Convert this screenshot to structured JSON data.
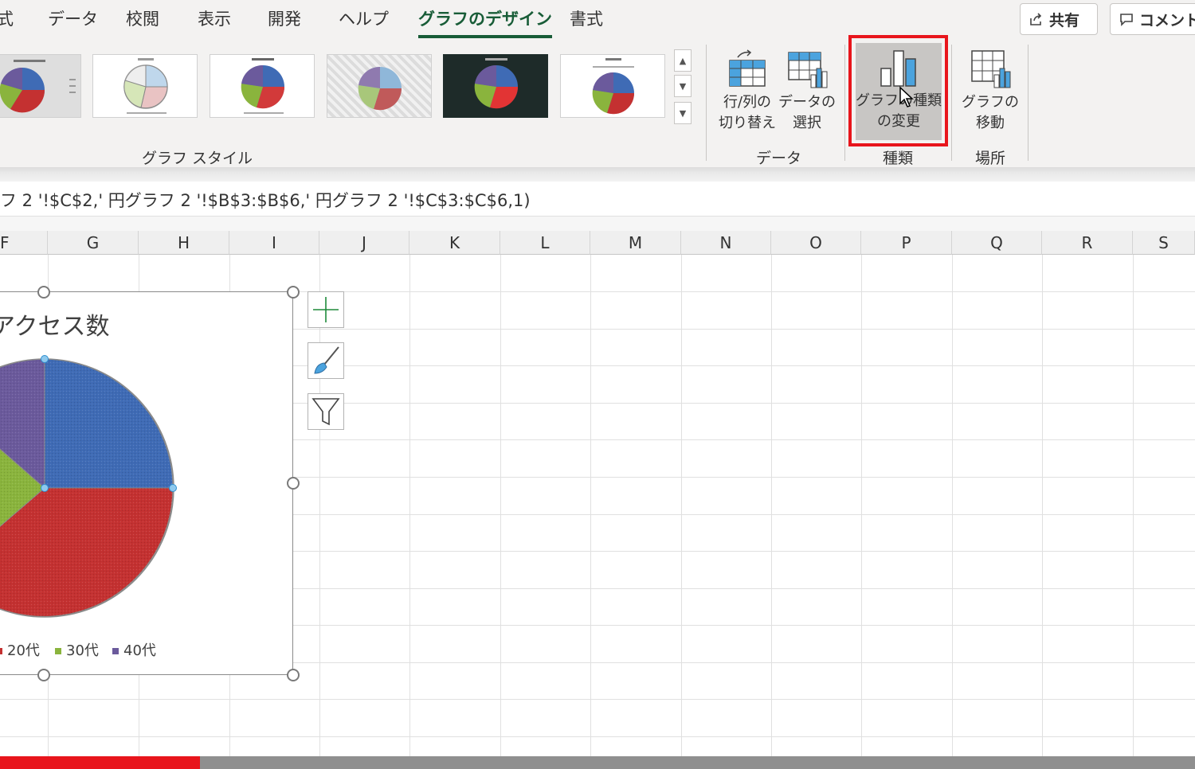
{
  "tabs": [
    {
      "label": "式",
      "active": false
    },
    {
      "label": "データ",
      "active": false
    },
    {
      "label": "校閲",
      "active": false
    },
    {
      "label": "表示",
      "active": false
    },
    {
      "label": "開発",
      "active": false
    },
    {
      "label": "ヘルプ",
      "active": false
    },
    {
      "label": "グラフのデザイン",
      "active": true
    },
    {
      "label": "書式",
      "active": false
    }
  ],
  "top_buttons": {
    "share": "共有",
    "comment": "コメント"
  },
  "ribbon": {
    "styles_group_label": "グラフ スタイル",
    "data_group": {
      "label": "データ",
      "switch_row_col": [
        "行/列の",
        "切り替え"
      ],
      "select_data": [
        "データの",
        "選択"
      ]
    },
    "type_group": {
      "label": "種類",
      "change_chart_type": [
        "グラフの種類",
        "の変更"
      ]
    },
    "location_group": {
      "label": "場所",
      "move_chart": [
        "グラフの",
        "移動"
      ]
    }
  },
  "formula_text": "フ 2 '!$C$2,' 円グラフ 2 '!$B$3:$B$6,' 円グラフ 2 '!$C$3:$C$6,1)",
  "columns": [
    "F",
    "G",
    "H",
    "I",
    "J",
    "K",
    "L",
    "M",
    "N",
    "O",
    "P",
    "Q",
    "R",
    "S"
  ],
  "chart": {
    "title": "アクセス数",
    "legend": [
      {
        "label": "20代",
        "color": "#c43131"
      },
      {
        "label": "30代",
        "color": "#8ab43d"
      },
      {
        "label": "40代",
        "color": "#6b5a9c"
      }
    ]
  },
  "colors": {
    "accent_green": "#185c37",
    "highlight_red": "#e8151c",
    "pie_blue": "#3f6bb5"
  },
  "progress": 0.167
}
